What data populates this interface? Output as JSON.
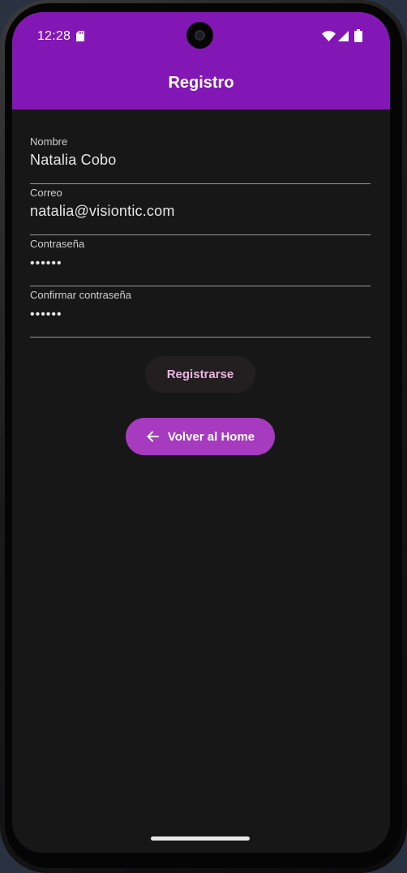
{
  "status_bar": {
    "time": "12:28"
  },
  "app_bar": {
    "title": "Registro",
    "color": "#8317b6"
  },
  "form": {
    "fields": [
      {
        "label": "Nombre",
        "value": "Natalia Cobo"
      },
      {
        "label": "Correo",
        "value": "natalia@visiontic.com"
      },
      {
        "label": "Contraseña",
        "value": "••••••"
      },
      {
        "label": "Confirmar contraseña",
        "value": "••••••"
      }
    ]
  },
  "buttons": {
    "register_label": "Registrarse",
    "home_label": "Volver al Home",
    "home_icon": "arrow-back-icon",
    "home_color": "#a63bbf"
  }
}
